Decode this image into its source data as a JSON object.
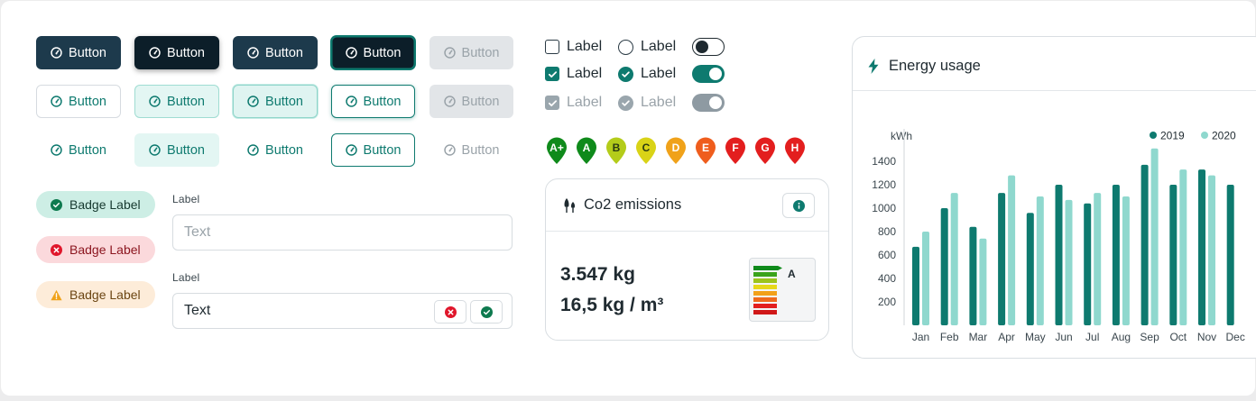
{
  "colors": {
    "primary": "#1d3a4c",
    "accent": "#0e7a6f",
    "accent_light": "#8fd8ce",
    "disabled": "#9aa3a9",
    "success": "#0e7a6f",
    "error": "#e0162b",
    "warning": "#f0a21a"
  },
  "buttons": {
    "label": "Button",
    "icon": "gauge-icon"
  },
  "badges": [
    {
      "label": "Badge Label",
      "icon": "check-circle-icon",
      "status": "success"
    },
    {
      "label": "Badge Label",
      "icon": "x-circle-icon",
      "status": "error"
    },
    {
      "label": "Badge Label",
      "icon": "warning-triangle-icon",
      "status": "warning"
    }
  ],
  "form": {
    "field1": {
      "label": "Label",
      "placeholder": "Text"
    },
    "field2": {
      "label": "Label",
      "value": "Text"
    }
  },
  "controls": {
    "label": "Label"
  },
  "energy_classes": [
    {
      "label": "A+",
      "color": "#0f8a1b"
    },
    {
      "label": "A",
      "color": "#0f8a1b"
    },
    {
      "label": "B",
      "color": "#b4cc1a"
    },
    {
      "label": "C",
      "color": "#d9d317"
    },
    {
      "label": "D",
      "color": "#f0a21a"
    },
    {
      "label": "E",
      "color": "#ef5d1d"
    },
    {
      "label": "F",
      "color": "#e31e1e"
    },
    {
      "label": "G",
      "color": "#e31e1e"
    },
    {
      "label": "H",
      "color": "#e31e1e"
    }
  ],
  "co2_card": {
    "title": "Co2 emissions",
    "value_1": "3.547 kg",
    "value_2": "16,5 kg / m³",
    "label_class": "A",
    "label_colors": [
      "#0f8a1b",
      "#3aa31a",
      "#9cc41b",
      "#e7d81a",
      "#f2a11a",
      "#ef6a1d",
      "#e31e1e",
      "#d01818"
    ]
  },
  "energy_card": {
    "title": "Energy usage"
  },
  "chart_data": {
    "type": "bar",
    "title": "Energy usage",
    "ylabel": "kWh",
    "xlabel": "",
    "ylim": [
      0,
      1500
    ],
    "yticks": [
      200,
      400,
      600,
      800,
      1000,
      1200,
      1400
    ],
    "grid": false,
    "legend_position": "top-right",
    "categories": [
      "Jan",
      "Feb",
      "Mar",
      "Apr",
      "May",
      "Jun",
      "Jul",
      "Aug",
      "Sep",
      "Oct",
      "Nov",
      "Dec"
    ],
    "series": [
      {
        "name": "2019",
        "color": "#0e7a6f",
        "values": [
          670,
          1000,
          840,
          1130,
          960,
          1200,
          1040,
          1200,
          1370,
          1200,
          1330,
          1200
        ]
      },
      {
        "name": "2020",
        "color": "#8fd8ce",
        "values": [
          800,
          1130,
          740,
          1280,
          1100,
          1070,
          1130,
          1100,
          1510,
          1330,
          1280,
          null
        ]
      }
    ]
  }
}
